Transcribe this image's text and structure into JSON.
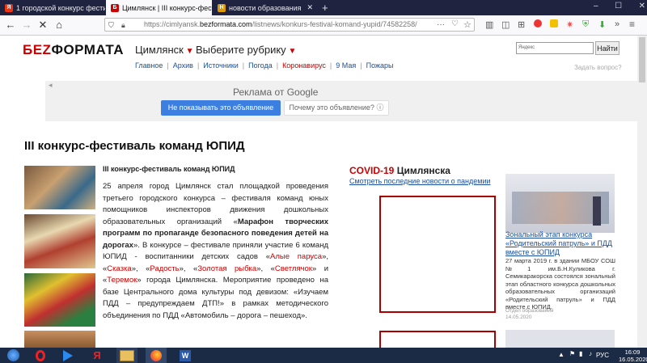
{
  "browser": {
    "tabs": [
      {
        "title": "1 городской конкурс фестива",
        "favicon": "yandex-icon",
        "active": false
      },
      {
        "title": "Цимлянск | III конкурс-фести",
        "favicon": "bezformata-icon",
        "active": true
      },
      {
        "title": "новости образования",
        "favicon": "site-icon",
        "active": false
      }
    ],
    "new_tab": "+",
    "url_prefix": "https://cimlyansk.",
    "url_domain": "bezformata.com",
    "url_suffix": "/listnews/konkurs-festival-komand-yupid/74582258/"
  },
  "site": {
    "logo_part1": "БЕZ",
    "logo_part2": "ФОРМАТА",
    "city": "Цимлянск",
    "rubric": "Выберите рубрику",
    "nav": [
      "Главное",
      "Архив",
      "Источники",
      "Погода",
      "Коронавирус",
      "9 Мая",
      "Пожары"
    ],
    "search_placeholder": "Яндекс",
    "search_button": "Найти",
    "ask": "Задать вопрос?"
  },
  "ad": {
    "title": "Реклама от Google",
    "hide_button": "Не показывать это объявление",
    "why_button": "Почему это объявление?",
    "info_glyph": "ⓘ"
  },
  "article": {
    "heading": "III конкурс-фестиваль команд ЮПИД",
    "subheading": "III конкурс-фестиваль команд ЮПИД",
    "p1": "25 апреля город Цимлянск стал площадкой проведения третьего городского конкурса – фестиваля команд юных помощников инспекторов движения дошкольных образовательных организаций «",
    "p1_bold": "Марафон творческих программ по пропаганде безопасного поведения детей на дорогах",
    "p2": "». В конкурсе – фестивале приняли участие 6 команд ЮПИД - воспитанники детских садов «",
    "k1": "Алые паруса",
    "k2": "Сказка",
    "k3": "Радость",
    "k4": "Золотая рыбка",
    "k5": "Светлячок",
    "k6": "Теремок",
    "p3": "» города Цимлянска. Мероприятие проведено на базе Центрального дома культуры под девизом: «Изучаем ПДД – предупреждаем ДТП!» в рамках методического объединения по ПДД «Автомобиль – дорога – пешеход»."
  },
  "covid": {
    "title_red": "COVID-19",
    "title_rest": " Цимлянска",
    "link": "Смотреть последние новости о пандемии"
  },
  "sidebar_news": {
    "title": "Зональный этап конкурса «Родительский патруль» и ПДД вместе с ЮПИД",
    "text": "27 марта 2019 г. в здании МБОУ СОШ №1 им.Б.Н.Куликова г. Семикаракорска состоялся зональный этап областного конкурса дошкольных образовательных организаций «Родительский патруль» и ПДД вместе с ЮПИД.",
    "source": "Отдел образования",
    "date": "14.05.2020"
  },
  "taskbar": {
    "lang": "РУС",
    "time": "16:09",
    "date": "16.05.2020"
  },
  "colors": {
    "accent_red": "#cc0000",
    "link_blue": "#1a4fa0",
    "ad_button": "#3d7fe0"
  }
}
